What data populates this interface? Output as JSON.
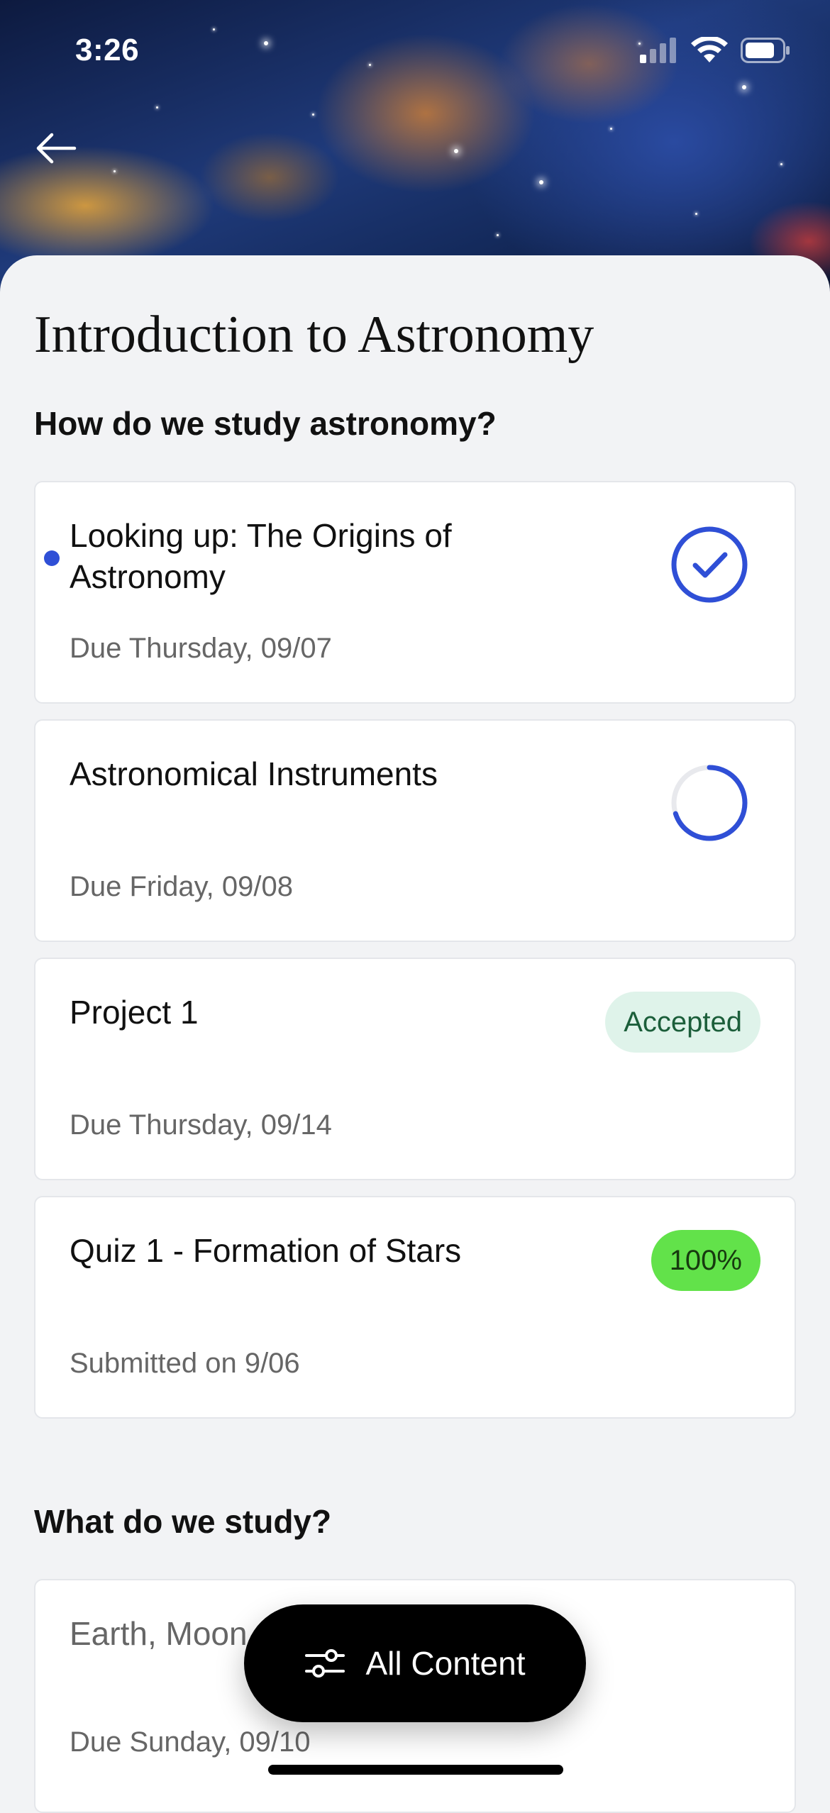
{
  "status_bar": {
    "time": "3:26"
  },
  "header": {
    "course_title": "Introduction to Astronomy"
  },
  "sections": [
    {
      "heading": "How do we study astronomy?",
      "items": [
        {
          "title": "Looking up: The Origins of Astronomy",
          "subtitle": "Due Thursday, 09/07",
          "status": "completed",
          "unread": true
        },
        {
          "title": "Astronomical Instruments",
          "subtitle": "Due Friday, 09/08",
          "status": "in-progress",
          "progress": 0.7
        },
        {
          "title": "Project 1",
          "subtitle": "Due Thursday, 09/14",
          "status_label": "Accepted"
        },
        {
          "title": "Quiz 1 - Formation of Stars",
          "subtitle": "Submitted on 9/06",
          "status_label": "100%"
        }
      ]
    },
    {
      "heading": "What do we study?",
      "items": [
        {
          "title": "Earth, Moon",
          "subtitle": "Due Sunday, 09/10"
        }
      ]
    }
  ],
  "filter_button": {
    "label": "All Content"
  },
  "colors": {
    "accent": "#2f4fd6",
    "accepted_bg": "#dff3ea",
    "score_bg": "#62e24a"
  }
}
